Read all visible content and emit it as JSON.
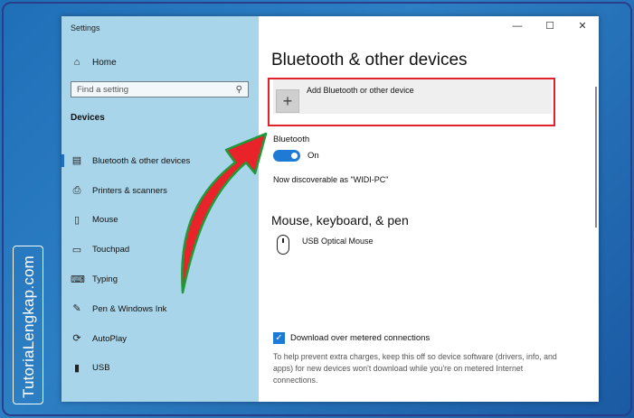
{
  "watermark": "TutoriaLengkap.com",
  "window": {
    "title": "Settings",
    "controls": {
      "minimize": "—",
      "maximize": "☐",
      "close": "✕"
    }
  },
  "sidebar": {
    "home": "Home",
    "search_placeholder": "Find a setting",
    "section": "Devices",
    "items": [
      {
        "label": "Bluetooth & other devices",
        "icon": "bluetooth-devices-icon",
        "glyph": "▤"
      },
      {
        "label": "Printers & scanners",
        "icon": "printer-icon",
        "glyph": "⎙"
      },
      {
        "label": "Mouse",
        "icon": "mouse-icon",
        "glyph": "▯"
      },
      {
        "label": "Touchpad",
        "icon": "touchpad-icon",
        "glyph": "▭"
      },
      {
        "label": "Typing",
        "icon": "keyboard-icon",
        "glyph": "⌨"
      },
      {
        "label": "Pen & Windows Ink",
        "icon": "pen-icon",
        "glyph": "✎"
      },
      {
        "label": "AutoPlay",
        "icon": "autoplay-icon",
        "glyph": "⟳"
      },
      {
        "label": "USB",
        "icon": "usb-icon",
        "glyph": "▮"
      }
    ]
  },
  "main": {
    "title": "Bluetooth & other devices",
    "add_device": "Add Bluetooth or other device",
    "bluetooth_label": "Bluetooth",
    "toggle_state": "On",
    "discoverable": "Now discoverable as \"WIDI-PC\"",
    "section_mouse": "Mouse, keyboard, & pen",
    "device_name": "USB Optical Mouse",
    "metered_label": "Download over metered connections",
    "metered_help": "To help prevent extra charges, keep this off so device software (drivers, info, and apps) for new devices won't download while you're on metered Internet connections."
  },
  "colors": {
    "sidebar": "#a9d5ea",
    "accent": "#1d7bd6",
    "highlight": "#e0222c",
    "arrow_fill": "#e8232a",
    "arrow_outline": "#1f9a3a"
  }
}
